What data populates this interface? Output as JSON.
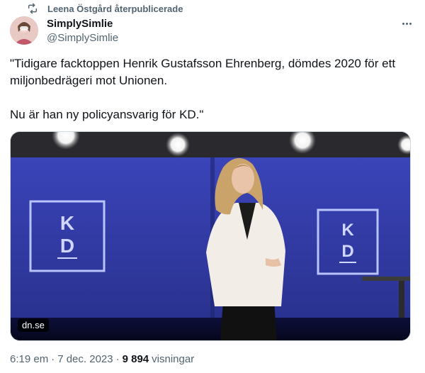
{
  "repost": {
    "text": "Leena Östgård återpublicerade"
  },
  "author": {
    "display_name": "SimplySimlie",
    "handle": "@SimplySimlie"
  },
  "tweet": {
    "text": "\"Tidigare facktoppen Henrik Gustafsson Ehrenberg, dömdes 2020 för ett miljonbedrägeri mot Unionen.\n\nNu är han ny policyansvarig för KD.\""
  },
  "media": {
    "domain": "dn.se",
    "sign_letters_top": "K",
    "sign_letters_bottom": "D"
  },
  "meta": {
    "time": "6:19 em",
    "separator": "·",
    "date": "7 dec. 2023",
    "views_count": "9 894",
    "views_label": "visningar"
  },
  "colors": {
    "text": "#0f1419",
    "secondary": "#536471",
    "border": "#cfd9de"
  }
}
